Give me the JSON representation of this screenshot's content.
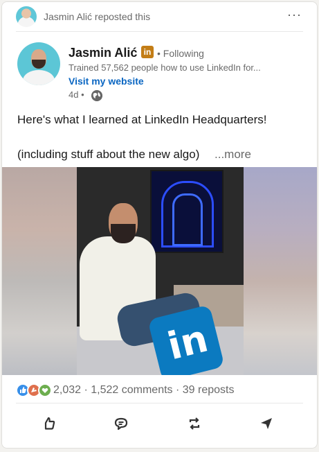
{
  "repost": {
    "text": "Jasmin Alić reposted this",
    "menu_label": "···"
  },
  "author": {
    "name": "Jasmin Alić",
    "badge": "in",
    "follow_status": "• Following",
    "headline": "Trained 57,562 people how to use LinkedIn for...",
    "website_label": "Visit my website",
    "time": "4d •",
    "visibility_icon": "globe-icon"
  },
  "post": {
    "line1": "Here's what I learned at LinkedIn Headquarters!",
    "line2": "(including stuff about the new algo)",
    "see_more": "...more",
    "image_pillow_text": "in"
  },
  "social": {
    "reactions": [
      "like-icon",
      "celebrate-icon",
      "support-icon"
    ],
    "counts": "2,032 · 1,522 comments · 39 reposts"
  },
  "actions": [
    {
      "name": "like",
      "icon": "thumbs-up-icon"
    },
    {
      "name": "comment",
      "icon": "comment-icon"
    },
    {
      "name": "repost",
      "icon": "repost-icon"
    },
    {
      "name": "send",
      "icon": "send-icon"
    }
  ],
  "colors": {
    "link": "#0a66c2",
    "premium_badge": "#c37d16",
    "avatar_bg": "#5cc6d6"
  }
}
